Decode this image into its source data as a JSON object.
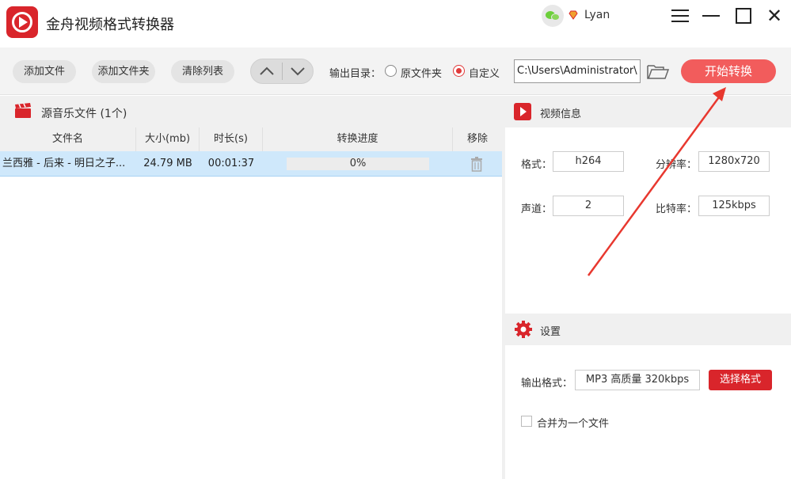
{
  "app": {
    "title": "金舟视频格式转换器",
    "user_name": "Lyan",
    "accent_color": "#d9252b",
    "start_button_color": "#f25c5c"
  },
  "window_controls": {
    "menu_icon": "hamburger-menu-icon",
    "minimize_icon": "minimize-icon",
    "maximize_icon": "maximize-icon",
    "close_icon": "close-icon",
    "close_glyph": "✕"
  },
  "toolbar": {
    "add_file": "添加文件",
    "add_folder": "添加文件夹",
    "clear_list": "清除列表",
    "output_dir_label": "输出目录：",
    "radio_original": "原文件夹",
    "radio_custom": "自定义",
    "custom_selected": true,
    "output_path": "C:\\Users\\Administrator\\",
    "start_button": "开始转换"
  },
  "file_list": {
    "title": "源音乐文件 (1个)",
    "columns": [
      "文件名",
      "大小(mb)",
      "时长(s)",
      "转换进度",
      "移除"
    ],
    "rows": [
      {
        "name": "兰西雅 - 后来 - 明日之子...",
        "size": "24.79 MB",
        "duration": "00:01:37",
        "progress": "0%",
        "progress_value": 0
      }
    ]
  },
  "video_info": {
    "title": "视频信息",
    "format_label": "格式：",
    "format_value": "h264",
    "resolution_label": "分辨率：",
    "resolution_value": "1280x720",
    "channels_label": "声道：",
    "channels_value": "2",
    "bitrate_label": "比特率：",
    "bitrate_value": "125kbps"
  },
  "settings": {
    "title": "设置",
    "output_format_label": "输出格式：",
    "output_format_value": "MP3 高质量 320kbps",
    "select_format_button": "选择格式",
    "merge_label": "合并为一个文件",
    "merge_checked": false
  },
  "annotation": {
    "arrow_color": "#e8382f"
  }
}
